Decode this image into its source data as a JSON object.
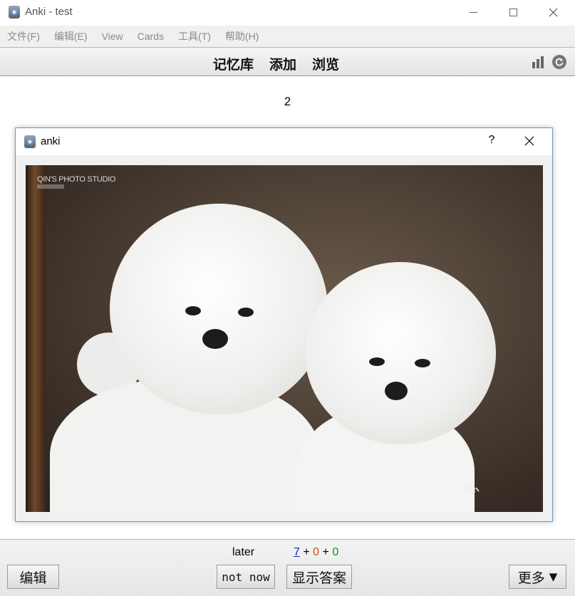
{
  "window": {
    "title": "Anki - test",
    "controls": {
      "minimize": "minimize",
      "maximize": "maximize",
      "close": "close"
    }
  },
  "menu": {
    "items": [
      {
        "label": "文件(F)"
      },
      {
        "label": "编辑(E)"
      },
      {
        "label": "View"
      },
      {
        "label": "Cards"
      },
      {
        "label": "工具(T)"
      },
      {
        "label": "帮助(H)"
      }
    ]
  },
  "toolbar": {
    "decks": "记忆库",
    "add": "添加",
    "browse": "浏览",
    "stats_icon": "stats-icon",
    "sync_icon": "sync-icon"
  },
  "card": {
    "number": "2"
  },
  "dialog": {
    "title": "anki",
    "help": "?",
    "image": {
      "watermark": "QIN'S PHOTO STUDIO"
    }
  },
  "bottom": {
    "later_label": "later",
    "counts": {
      "new": "7",
      "learning": "0",
      "review": "0",
      "plus": "+"
    },
    "edit_button": "编辑",
    "not_now_button": "not now",
    "show_answer_button": "显示答案",
    "more_button": "更多",
    "more_arrow": "▼"
  },
  "colors": {
    "new": "#1a27c8",
    "learning": "#d24a1a",
    "review": "#1b8a1b"
  }
}
